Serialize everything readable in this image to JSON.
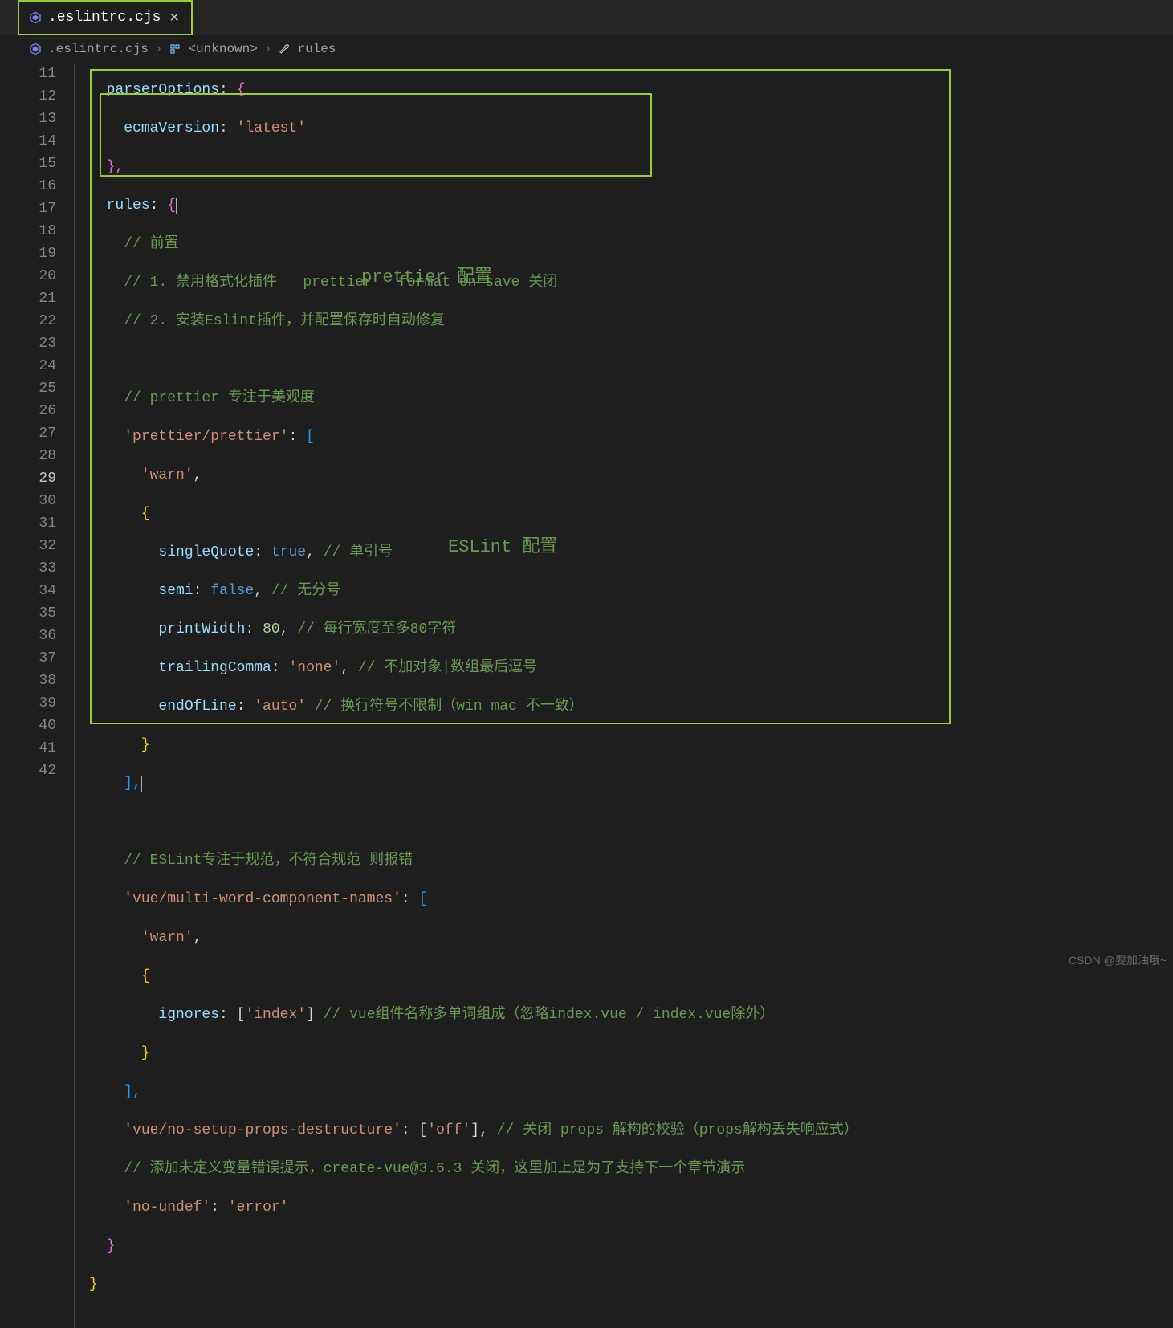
{
  "tab": {
    "filename": ".eslintrc.cjs"
  },
  "breadcrumb": {
    "file": ".eslintrc.cjs",
    "scope": "<unknown>",
    "prop": "rules"
  },
  "labels": {
    "prettier": "prettier 配置",
    "eslint": "ESLint 配置"
  },
  "watermark": "CSDN @要加油哦~",
  "lines": {
    "start": 11,
    "end": 42,
    "current": 29
  },
  "code": {
    "l11_key": "parserOptions",
    "l11_brace": "{",
    "l12_key": "ecmaVersion",
    "l12_val": "'latest'",
    "l13": "},",
    "l14_key": "rules",
    "l14_brace": "{",
    "l15": "// 前置",
    "l16": "// 1. 禁用格式化插件   prettier   format on save 关闭",
    "l17": "// 2. 安装Eslint插件，并配置保存时自动修复",
    "l19": "// prettier 专注于美观度",
    "l20_key": "'prettier/prettier'",
    "l20_brk": "[",
    "l21": "'warn'",
    "l22": "{",
    "l23_key": "singleQuote",
    "l23_val": "true",
    "l23_cmt": "// 单引号",
    "l24_key": "semi",
    "l24_val": "false",
    "l24_cmt": "// 无分号",
    "l25_key": "printWidth",
    "l25_val": "80",
    "l25_cmt": "// 每行宽度至多80字符",
    "l26_key": "trailingComma",
    "l26_val": "'none'",
    "l26_cmt": "// 不加对象|数组最后逗号",
    "l27_key": "endOfLine",
    "l27_val": "'auto'",
    "l27_cmt": "// 换行符号不限制（win mac 不一致）",
    "l28": "}",
    "l29": "],",
    "l31": "// ESLint专注于规范，不符合规范 则报错",
    "l32_key": "'vue/multi-word-component-names'",
    "l32_brk": "[",
    "l33": "'warn'",
    "l34": "{",
    "l35_key": "ignores",
    "l35_val": "'index'",
    "l35_cmt": "// vue组件名称多单词组成（忽略index.vue / index.vue除外）",
    "l36": "}",
    "l37": "],",
    "l38_key": "'vue/no-setup-props-destructure'",
    "l38_val": "'off'",
    "l38_cmt": "// 关闭 props 解构的校验（props解构丢失响应式）",
    "l39": "// 添加未定义变量错误提示，create-vue@3.6.3 关闭，这里加上是为了支持下一个章节演示",
    "l40_key": "'no-undef'",
    "l40_val": "'error'",
    "l41": "}",
    "l42": "}"
  }
}
